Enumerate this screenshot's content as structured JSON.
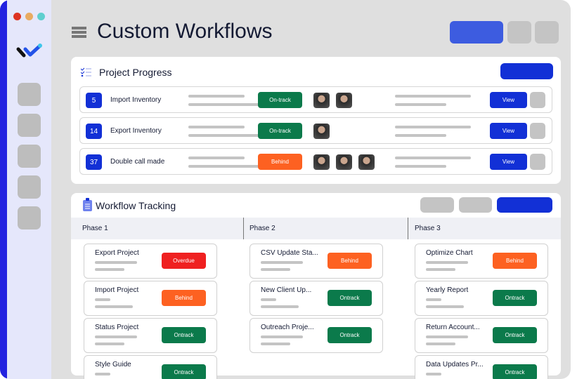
{
  "title": "Custom Workflows",
  "colors": {
    "accent": "#1230d6",
    "ontrack": "#0b7a4b",
    "behind": "#fd6121",
    "overdue": "#ef2020"
  },
  "progress": {
    "title": "Project Progress",
    "view_label": "View",
    "rows": [
      {
        "num": "5",
        "name": "Import Inventory",
        "status": "On-track",
        "avatars": 2
      },
      {
        "num": "14",
        "name": "Export Inventory",
        "status": "On-track",
        "avatars": 1
      },
      {
        "num": "37",
        "name": "Double call made",
        "status": "Behind",
        "avatars": 3
      }
    ]
  },
  "tracking": {
    "title": "Workflow Tracking",
    "phases": [
      {
        "label": "Phase 1",
        "cards": [
          {
            "name": "Export Project",
            "status": "Overdue"
          },
          {
            "name": "Import Project",
            "status": "Behind"
          },
          {
            "name": "Status Project",
            "status": "Ontrack"
          },
          {
            "name": "Style Guide",
            "status": "Ontrack"
          }
        ]
      },
      {
        "label": "Phase 2",
        "cards": [
          {
            "name": "CSV Update Sta...",
            "status": "Behind"
          },
          {
            "name": "New Client Up...",
            "status": "Ontrack"
          },
          {
            "name": "Outreach Proje...",
            "status": "Ontrack"
          }
        ]
      },
      {
        "label": "Phase 3",
        "cards": [
          {
            "name": "Optimize Chart",
            "status": "Behind"
          },
          {
            "name": "Yearly Report",
            "status": "Ontrack"
          },
          {
            "name": "Return Account...",
            "status": "Ontrack"
          },
          {
            "name": "Data Updates Pr...",
            "status": "Ontrack"
          }
        ]
      }
    ]
  }
}
